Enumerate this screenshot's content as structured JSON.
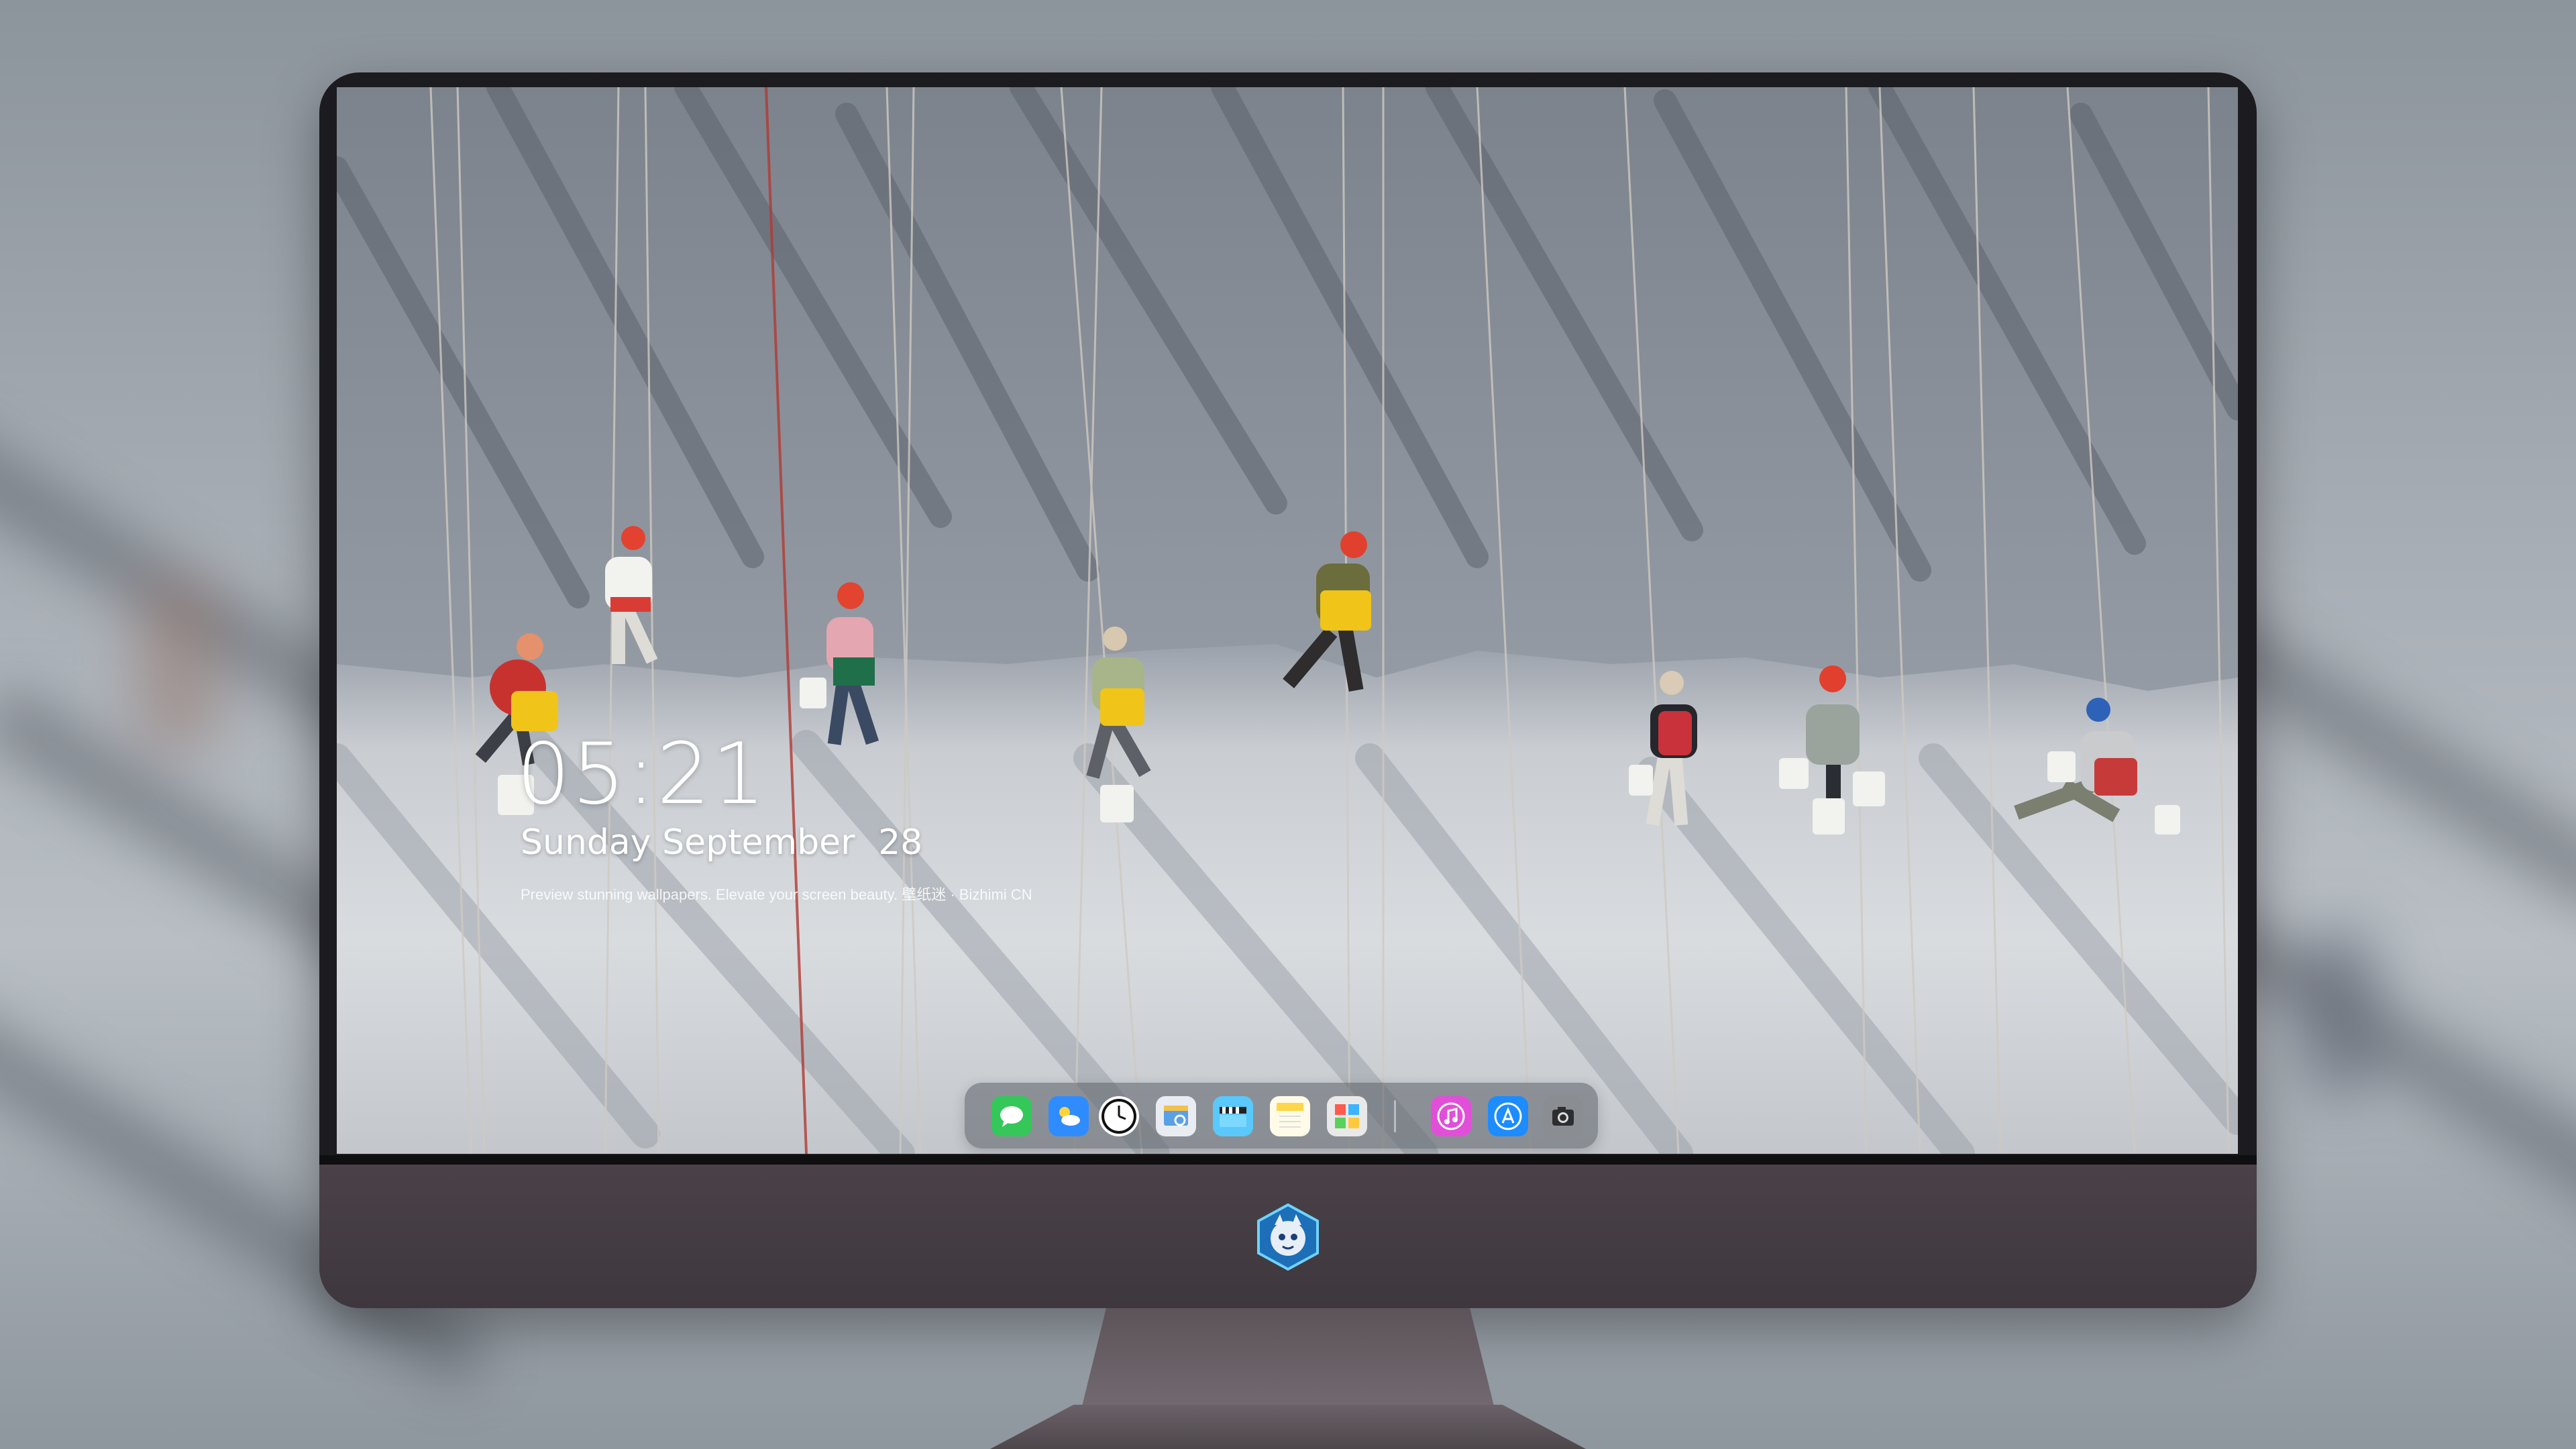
{
  "lockscreen": {
    "time": "05:21",
    "weekday": "Sunday",
    "month": "September",
    "day": "28",
    "caption": "Preview stunning wallpapers. Elevate your screen beauty. 壁纸迷 · Bizhimi CN"
  },
  "dock": {
    "apps": [
      {
        "name": "messages-icon",
        "color": "#35c759"
      },
      {
        "name": "weather-icon",
        "color": "#2f8cff"
      },
      {
        "name": "clock-icon",
        "color": "#ffffff"
      },
      {
        "name": "preview-icon",
        "color": "#f2c14e"
      },
      {
        "name": "final-cut-icon",
        "color": "#5ac8fa"
      },
      {
        "name": "notes-icon",
        "color": "#ffd64a"
      },
      {
        "name": "photo-booth-icon",
        "color": "#e9e9e9"
      },
      {
        "name": "itunes-icon",
        "color": "#e14fd8"
      },
      {
        "name": "app-store-icon",
        "color": "#1c8cff"
      },
      {
        "name": "camera-icon",
        "color": "#8a8d92"
      }
    ]
  },
  "colors": {
    "bezel": "#1c1b1f",
    "chin": "#433c41",
    "helmet_red": "#e0392a",
    "harness_yellow": "#f0c419"
  }
}
